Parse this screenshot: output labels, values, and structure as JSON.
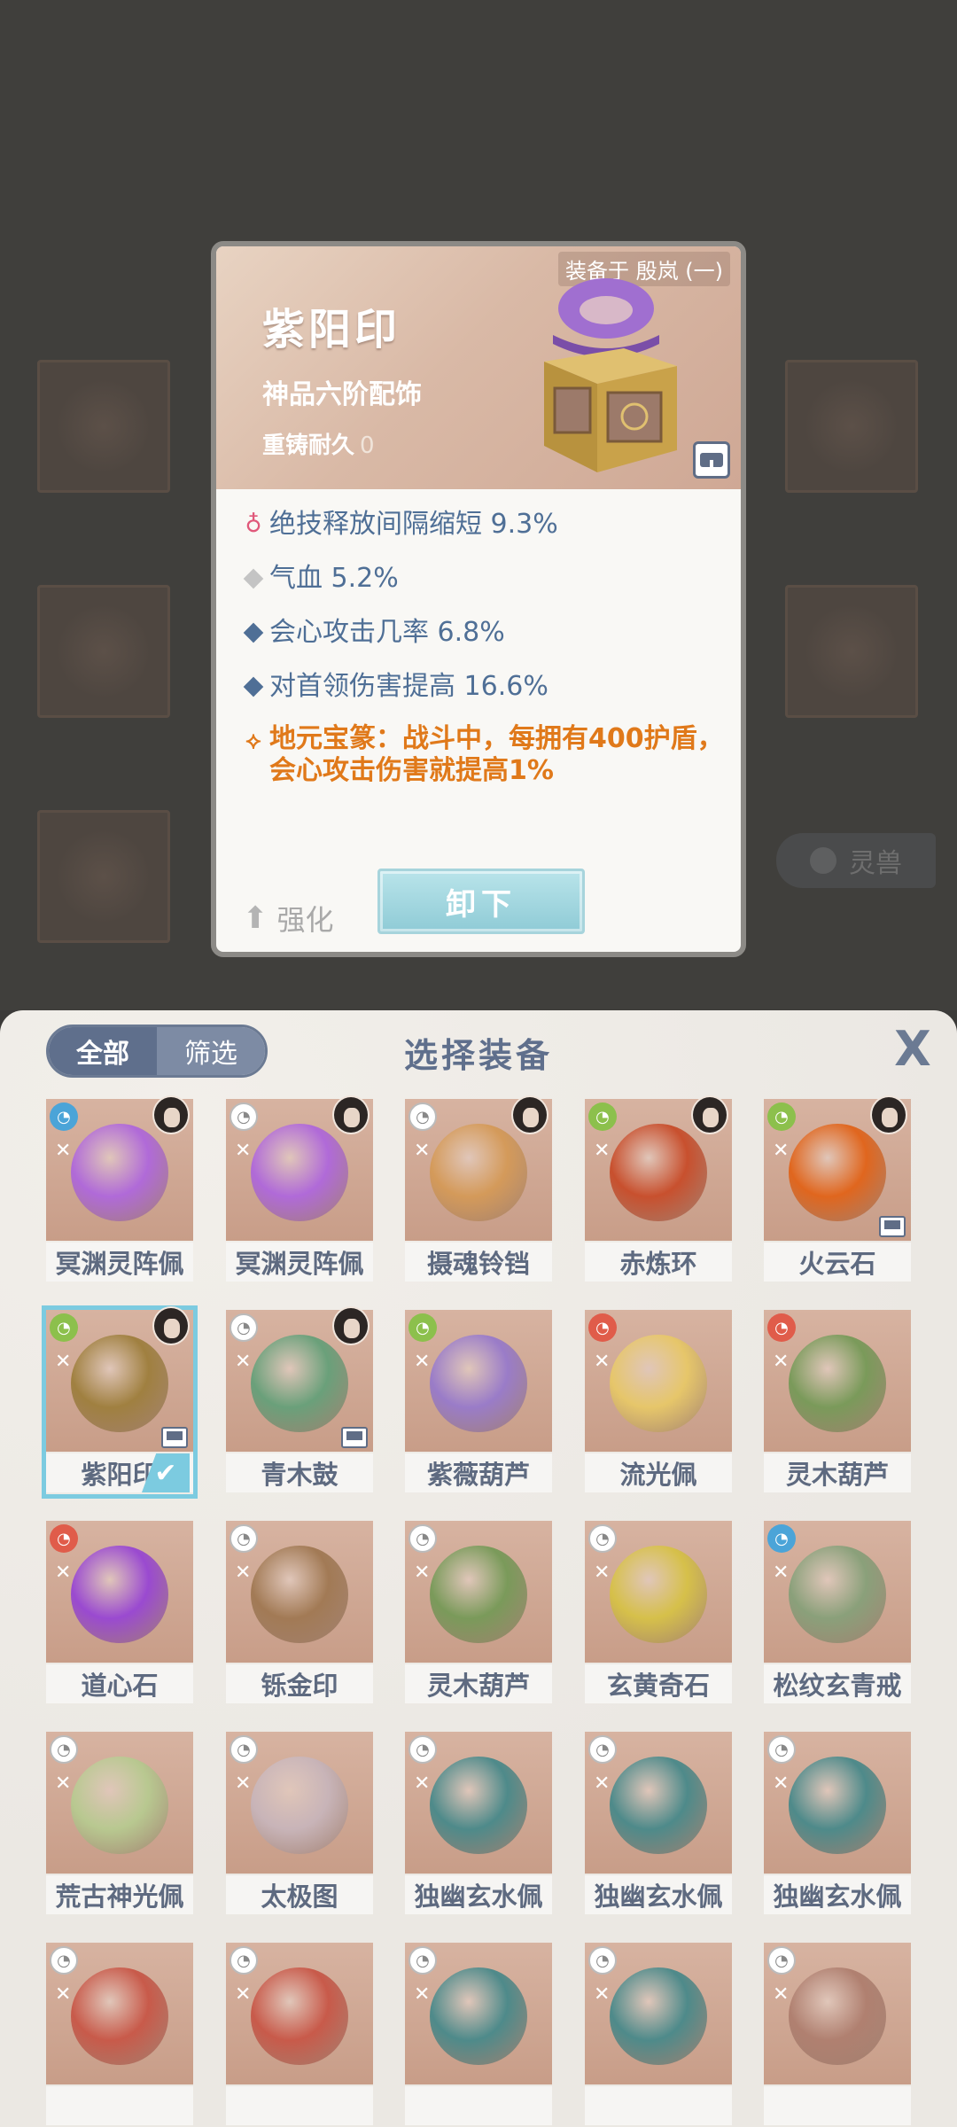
{
  "detail": {
    "equipped_on": "装备于 殷岚 (一)",
    "name": "紫阳印",
    "grade": "神品六阶配饰",
    "durability_label": "重铸耐久",
    "durability_value": "0",
    "stats": [
      {
        "text": "绝技释放间隔缩短 9.3%",
        "icon": "flame-icon"
      },
      {
        "text": "气血 5.2%",
        "icon": "grey-diamond-icon"
      },
      {
        "text": "会心攻击几率 6.8%",
        "icon": "blue-diamond-icon"
      },
      {
        "text": "对首领伤害提高 16.6%",
        "icon": "blue-diamond-icon"
      }
    ],
    "special": "地元宝篆：战斗中，每拥有400护盾，会心攻击伤害就提高1%",
    "strengthen_label": "强化",
    "unequip_label": "卸下"
  },
  "background": {
    "tag_label": "灵兽"
  },
  "panel": {
    "title": "选择装备",
    "tab_all": "全部",
    "tab_filter": "筛选",
    "close": "X"
  },
  "items": [
    {
      "name": "冥渊灵阵佩",
      "badge": "b-blue",
      "avatar": true,
      "color": "#b06ad8"
    },
    {
      "name": "冥渊灵阵佩",
      "badge": "b-grey",
      "avatar": true,
      "color": "#b06ad8"
    },
    {
      "name": "摄魂铃铛",
      "badge": "b-grey",
      "avatar": true,
      "color": "#d49a5a"
    },
    {
      "name": "赤炼环",
      "badge": "b-green",
      "avatar": true,
      "color": "#c8502e"
    },
    {
      "name": "火云石",
      "badge": "b-green",
      "avatar": true,
      "chest": true,
      "color": "#e0661e"
    },
    {
      "name": "紫阳印",
      "badge": "b-green",
      "avatar": true,
      "chest": true,
      "selected": true,
      "color": "#a08040"
    },
    {
      "name": "青木鼓",
      "badge": "b-grey",
      "avatar": true,
      "chest": true,
      "color": "#6aa07a"
    },
    {
      "name": "紫薇葫芦",
      "badge": "b-green",
      "color": "#9a7cc8"
    },
    {
      "name": "流光佩",
      "badge": "b-red",
      "color": "#e6c66a"
    },
    {
      "name": "灵木葫芦",
      "badge": "b-red",
      "color": "#7a9a5a"
    },
    {
      "name": "道心石",
      "badge": "b-red",
      "color": "#9a4ad0"
    },
    {
      "name": "铄金印",
      "badge": "b-grey",
      "color": "#a27a55"
    },
    {
      "name": "灵木葫芦",
      "badge": "b-grey",
      "color": "#7a9a5a"
    },
    {
      "name": "玄黄奇石",
      "badge": "b-grey",
      "color": "#d6c04a"
    },
    {
      "name": "松纹玄青戒",
      "badge": "b-blue",
      "color": "#8aa07a"
    },
    {
      "name": "荒古神光佩",
      "badge": "b-grey",
      "color": "#b8c890"
    },
    {
      "name": "太极图",
      "badge": "b-grey",
      "color": "#c8b4b8"
    },
    {
      "name": "独幽玄水佩",
      "badge": "b-grey",
      "color": "#4e8a8a"
    },
    {
      "name": "独幽玄水佩",
      "badge": "b-grey",
      "color": "#4e8a8a"
    },
    {
      "name": "独幽玄水佩",
      "badge": "b-grey",
      "color": "#4e8a8a"
    },
    {
      "name": "",
      "badge": "b-grey",
      "color": "#c85a4a"
    },
    {
      "name": "",
      "badge": "b-grey",
      "color": "#c85a4a"
    },
    {
      "name": "",
      "badge": "b-grey",
      "color": "#4e8a8a"
    },
    {
      "name": "",
      "badge": "b-grey",
      "color": "#4e8a8a"
    },
    {
      "name": "",
      "badge": "b-grey",
      "color": "#b08070"
    }
  ]
}
